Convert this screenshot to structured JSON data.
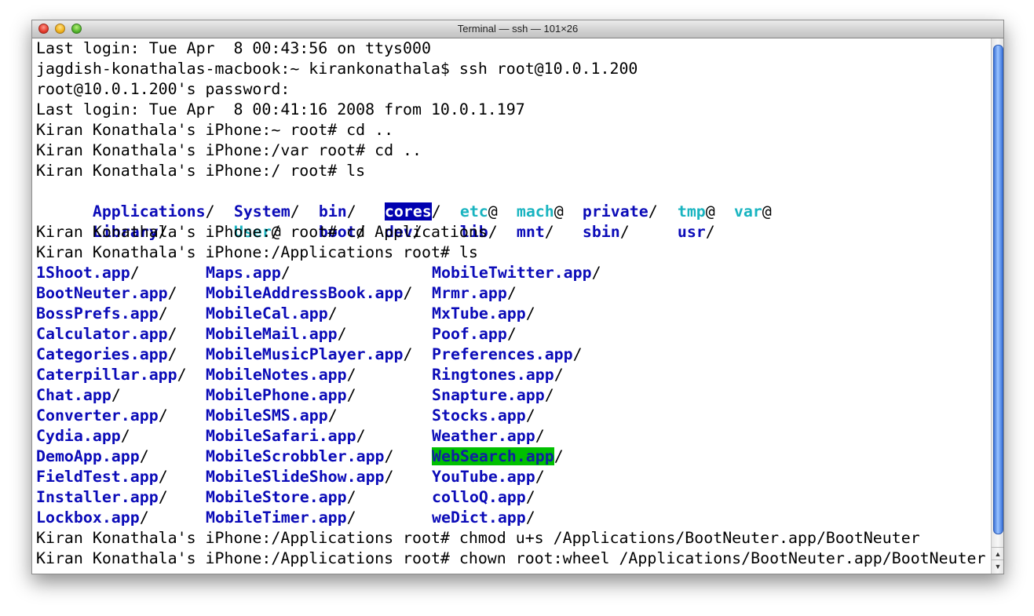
{
  "window": {
    "title": "Terminal — ssh — 101×26"
  },
  "colors": {
    "directory": "#0b0bb8",
    "symlink": "#19b4c0",
    "highlight_blue": "#0000b0",
    "highlight_green": "#00c000",
    "scrollbar_thumb": "#3e74d8"
  },
  "lines_top": [
    "Last login: Tue Apr  8 00:43:56 on ttys000",
    "jagdish-konathalas-macbook:~ kirankonathala$ ssh root@10.0.1.200",
    "root@10.0.1.200's password:",
    "Last login: Tue Apr  8 00:41:16 2008 from 10.0.1.197",
    "Kiran Konathala's iPhone:~ root# cd ..",
    "Kiran Konathala's iPhone:/var root# cd ..",
    "Kiran Konathala's iPhone:/ root# ls"
  ],
  "root_listing": {
    "row1": [
      {
        "name": "Applications",
        "suffix": "/"
      },
      {
        "name": "System",
        "suffix": "/"
      },
      {
        "name": "bin",
        "suffix": "/"
      },
      {
        "name": "cores",
        "suffix": "/"
      },
      {
        "name": "etc",
        "suffix": "@"
      },
      {
        "name": "mach",
        "suffix": "@"
      },
      {
        "name": "private",
        "suffix": "/"
      },
      {
        "name": "tmp",
        "suffix": "@"
      },
      {
        "name": "var",
        "suffix": "@"
      }
    ],
    "row2": [
      {
        "name": "Library",
        "suffix": "/"
      },
      {
        "name": "User",
        "suffix": "@"
      },
      {
        "name": "boot",
        "suffix": "/"
      },
      {
        "name": "dev",
        "suffix": "/"
      },
      {
        "name": "lib",
        "suffix": "/"
      },
      {
        "name": "mnt",
        "suffix": "/"
      },
      {
        "name": "sbin",
        "suffix": "/"
      },
      {
        "name": "usr",
        "suffix": "/"
      }
    ]
  },
  "lines_mid": [
    "Kiran Konathala's iPhone:/ root# cd Applications",
    "Kiran Konathala's iPhone:/Applications root# ls"
  ],
  "apps": [
    [
      "1Shoot.app",
      "Maps.app",
      "MobileTwitter.app"
    ],
    [
      "BootNeuter.app",
      "MobileAddressBook.app",
      "Mrmr.app"
    ],
    [
      "BossPrefs.app",
      "MobileCal.app",
      "MxTube.app"
    ],
    [
      "Calculator.app",
      "MobileMail.app",
      "Poof.app"
    ],
    [
      "Categories.app",
      "MobileMusicPlayer.app",
      "Preferences.app"
    ],
    [
      "Caterpillar.app",
      "MobileNotes.app",
      "Ringtones.app"
    ],
    [
      "Chat.app",
      "MobilePhone.app",
      "Snapture.app"
    ],
    [
      "Converter.app",
      "MobileSMS.app",
      "Stocks.app"
    ],
    [
      "Cydia.app",
      "MobileSafari.app",
      "Weather.app"
    ],
    [
      "DemoApp.app",
      "MobileScrobbler.app",
      "WebSearch.app"
    ],
    [
      "FieldTest.app",
      "MobileSlideShow.app",
      "YouTube.app"
    ],
    [
      "Installer.app",
      "MobileStore.app",
      "colloQ.app"
    ],
    [
      "Lockbox.app",
      "MobileTimer.app",
      "weDict.app"
    ]
  ],
  "lines_bottom": [
    "Kiran Konathala's iPhone:/Applications root# chmod u+s /Applications/BootNeuter.app/BootNeuter",
    "Kiran Konathala's iPhone:/Applications root# chown root:wheel /Applications/BootNeuter.app/BootNeuter"
  ],
  "scrollbar": {
    "up_icon": "▲",
    "down_icon": "▼"
  }
}
